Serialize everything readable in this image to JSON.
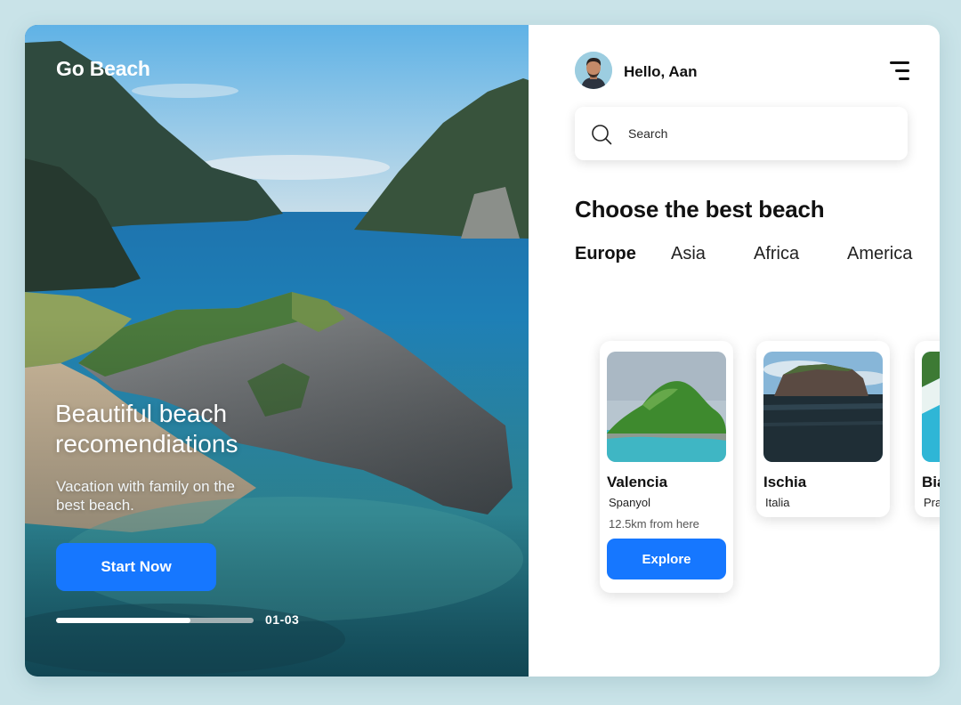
{
  "app": {
    "brand": "Go Beach"
  },
  "hero": {
    "title": "Beautiful beach recomendiations",
    "subtitle": "Vacation with family on the best beach.",
    "cta_label": "Start Now",
    "progress": 0.68,
    "slide_counter": "01-03"
  },
  "header": {
    "greeting": "Hello, Aan"
  },
  "search": {
    "placeholder": "Search"
  },
  "section": {
    "title": "Choose the best beach"
  },
  "tabs": [
    {
      "label": "Europe",
      "active": true
    },
    {
      "label": "Asia",
      "active": false
    },
    {
      "label": "Africa",
      "active": false
    },
    {
      "label": "America",
      "active": false
    }
  ],
  "cards": [
    {
      "name": "Valencia",
      "country": "Spanyol",
      "distance": "12.5km from here",
      "button_label": "Explore"
    },
    {
      "name": "Ischia",
      "country": "Italia"
    },
    {
      "name": "Biarritz",
      "country": "Prancis"
    }
  ],
  "colors": {
    "accent": "#1677ff",
    "background": "#c9e3e8",
    "panel": "#ffffff",
    "text": "#111111"
  },
  "icons": {
    "search": "search-icon",
    "menu": "menu-icon"
  }
}
